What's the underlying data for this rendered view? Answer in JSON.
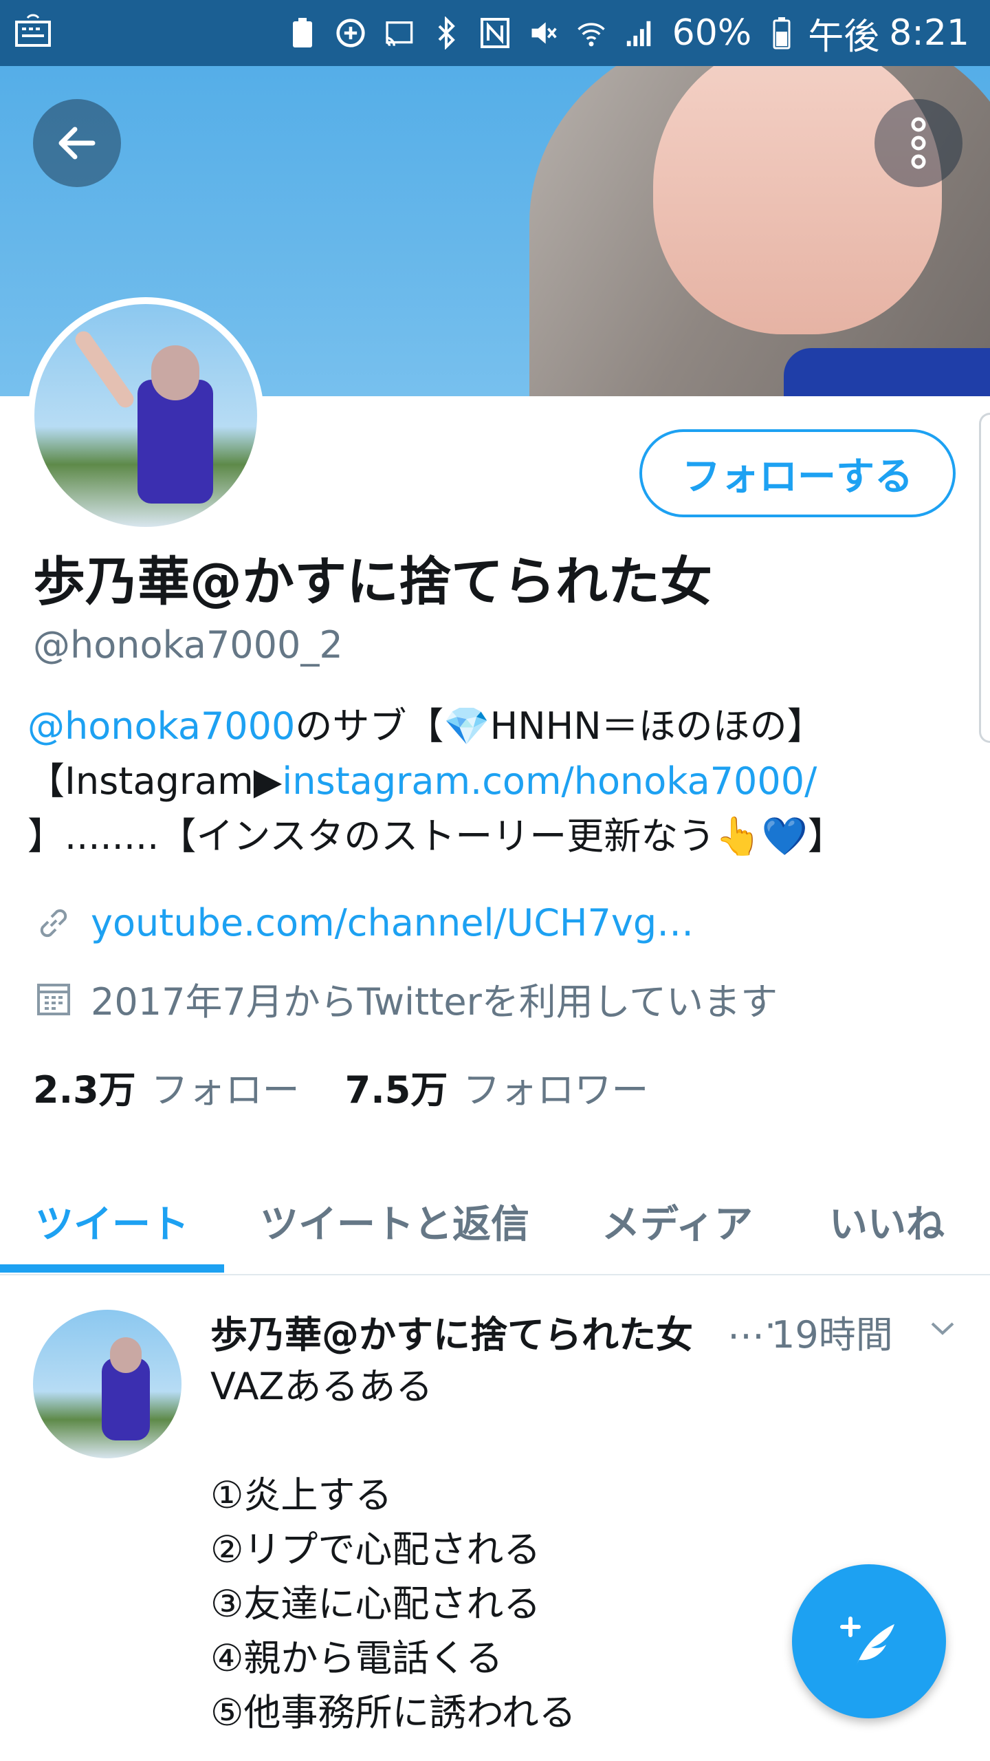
{
  "status_bar": {
    "battery_percent": "60%",
    "time_prefix": "午後",
    "time": "8:21",
    "icons": [
      "keyboard-icon",
      "battery-saver-icon",
      "add-circle-icon",
      "cast-icon",
      "bluetooth-icon",
      "nfc-icon",
      "mute-icon",
      "wifi-icon",
      "signal-icon",
      "battery-icon"
    ]
  },
  "profile": {
    "display_name": "歩乃華@かすに捨てられた女",
    "handle": "@honoka7000_2",
    "follow_label": "フォローする",
    "bio": {
      "mention": "@honoka7000",
      "line1_rest": "のサブ【💎HNHN＝ほのほの】",
      "line2_prefix": "【Instagram▶",
      "line2_link": "instagram.com/honoka7000/",
      "line3": "】........【インスタのストーリー更新なう👆💙】"
    },
    "website": "youtube.com/channel/UCH7vg…",
    "joined": "2017年7月からTwitterを利用しています",
    "following_count": "2.3万",
    "following_label": "フォロー",
    "followers_count": "7.5万",
    "followers_label": "フォロワー"
  },
  "tabs": [
    "ツイート",
    "ツイートと返信",
    "メディア",
    "いいね"
  ],
  "active_tab": 0,
  "tweet": {
    "name": "歩乃華@かすに捨てられた女",
    "ellipsis": "…·",
    "time": "19時間",
    "lines": [
      "VAZあるある",
      "",
      "①炎上する",
      "②リプで心配される",
      "③友達に心配される",
      "④親から電話くる",
      "⑤他事務所に誘われる"
    ]
  },
  "colors": {
    "accent": "#1da1f2",
    "status_bar": "#1b5f93",
    "secondary_text": "#657786"
  }
}
